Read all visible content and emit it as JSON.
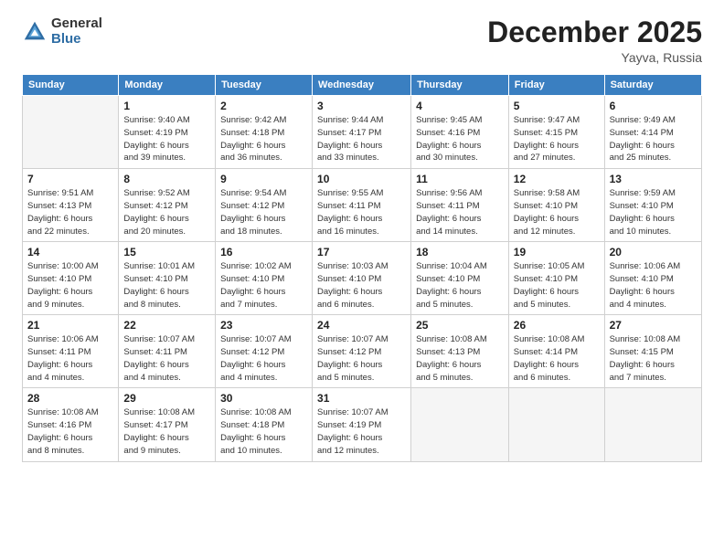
{
  "logo": {
    "general": "General",
    "blue": "Blue"
  },
  "title": "December 2025",
  "location": "Yayva, Russia",
  "days_of_week": [
    "Sunday",
    "Monday",
    "Tuesday",
    "Wednesday",
    "Thursday",
    "Friday",
    "Saturday"
  ],
  "weeks": [
    [
      {
        "day": "",
        "info": ""
      },
      {
        "day": "1",
        "info": "Sunrise: 9:40 AM\nSunset: 4:19 PM\nDaylight: 6 hours\nand 39 minutes."
      },
      {
        "day": "2",
        "info": "Sunrise: 9:42 AM\nSunset: 4:18 PM\nDaylight: 6 hours\nand 36 minutes."
      },
      {
        "day": "3",
        "info": "Sunrise: 9:44 AM\nSunset: 4:17 PM\nDaylight: 6 hours\nand 33 minutes."
      },
      {
        "day": "4",
        "info": "Sunrise: 9:45 AM\nSunset: 4:16 PM\nDaylight: 6 hours\nand 30 minutes."
      },
      {
        "day": "5",
        "info": "Sunrise: 9:47 AM\nSunset: 4:15 PM\nDaylight: 6 hours\nand 27 minutes."
      },
      {
        "day": "6",
        "info": "Sunrise: 9:49 AM\nSunset: 4:14 PM\nDaylight: 6 hours\nand 25 minutes."
      }
    ],
    [
      {
        "day": "7",
        "info": "Sunrise: 9:51 AM\nSunset: 4:13 PM\nDaylight: 6 hours\nand 22 minutes."
      },
      {
        "day": "8",
        "info": "Sunrise: 9:52 AM\nSunset: 4:12 PM\nDaylight: 6 hours\nand 20 minutes."
      },
      {
        "day": "9",
        "info": "Sunrise: 9:54 AM\nSunset: 4:12 PM\nDaylight: 6 hours\nand 18 minutes."
      },
      {
        "day": "10",
        "info": "Sunrise: 9:55 AM\nSunset: 4:11 PM\nDaylight: 6 hours\nand 16 minutes."
      },
      {
        "day": "11",
        "info": "Sunrise: 9:56 AM\nSunset: 4:11 PM\nDaylight: 6 hours\nand 14 minutes."
      },
      {
        "day": "12",
        "info": "Sunrise: 9:58 AM\nSunset: 4:10 PM\nDaylight: 6 hours\nand 12 minutes."
      },
      {
        "day": "13",
        "info": "Sunrise: 9:59 AM\nSunset: 4:10 PM\nDaylight: 6 hours\nand 10 minutes."
      }
    ],
    [
      {
        "day": "14",
        "info": "Sunrise: 10:00 AM\nSunset: 4:10 PM\nDaylight: 6 hours\nand 9 minutes."
      },
      {
        "day": "15",
        "info": "Sunrise: 10:01 AM\nSunset: 4:10 PM\nDaylight: 6 hours\nand 8 minutes."
      },
      {
        "day": "16",
        "info": "Sunrise: 10:02 AM\nSunset: 4:10 PM\nDaylight: 6 hours\nand 7 minutes."
      },
      {
        "day": "17",
        "info": "Sunrise: 10:03 AM\nSunset: 4:10 PM\nDaylight: 6 hours\nand 6 minutes."
      },
      {
        "day": "18",
        "info": "Sunrise: 10:04 AM\nSunset: 4:10 PM\nDaylight: 6 hours\nand 5 minutes."
      },
      {
        "day": "19",
        "info": "Sunrise: 10:05 AM\nSunset: 4:10 PM\nDaylight: 6 hours\nand 5 minutes."
      },
      {
        "day": "20",
        "info": "Sunrise: 10:06 AM\nSunset: 4:10 PM\nDaylight: 6 hours\nand 4 minutes."
      }
    ],
    [
      {
        "day": "21",
        "info": "Sunrise: 10:06 AM\nSunset: 4:11 PM\nDaylight: 6 hours\nand 4 minutes."
      },
      {
        "day": "22",
        "info": "Sunrise: 10:07 AM\nSunset: 4:11 PM\nDaylight: 6 hours\nand 4 minutes."
      },
      {
        "day": "23",
        "info": "Sunrise: 10:07 AM\nSunset: 4:12 PM\nDaylight: 6 hours\nand 4 minutes."
      },
      {
        "day": "24",
        "info": "Sunrise: 10:07 AM\nSunset: 4:12 PM\nDaylight: 6 hours\nand 5 minutes."
      },
      {
        "day": "25",
        "info": "Sunrise: 10:08 AM\nSunset: 4:13 PM\nDaylight: 6 hours\nand 5 minutes."
      },
      {
        "day": "26",
        "info": "Sunrise: 10:08 AM\nSunset: 4:14 PM\nDaylight: 6 hours\nand 6 minutes."
      },
      {
        "day": "27",
        "info": "Sunrise: 10:08 AM\nSunset: 4:15 PM\nDaylight: 6 hours\nand 7 minutes."
      }
    ],
    [
      {
        "day": "28",
        "info": "Sunrise: 10:08 AM\nSunset: 4:16 PM\nDaylight: 6 hours\nand 8 minutes."
      },
      {
        "day": "29",
        "info": "Sunrise: 10:08 AM\nSunset: 4:17 PM\nDaylight: 6 hours\nand 9 minutes."
      },
      {
        "day": "30",
        "info": "Sunrise: 10:08 AM\nSunset: 4:18 PM\nDaylight: 6 hours\nand 10 minutes."
      },
      {
        "day": "31",
        "info": "Sunrise: 10:07 AM\nSunset: 4:19 PM\nDaylight: 6 hours\nand 12 minutes."
      },
      {
        "day": "",
        "info": ""
      },
      {
        "day": "",
        "info": ""
      },
      {
        "day": "",
        "info": ""
      }
    ]
  ]
}
